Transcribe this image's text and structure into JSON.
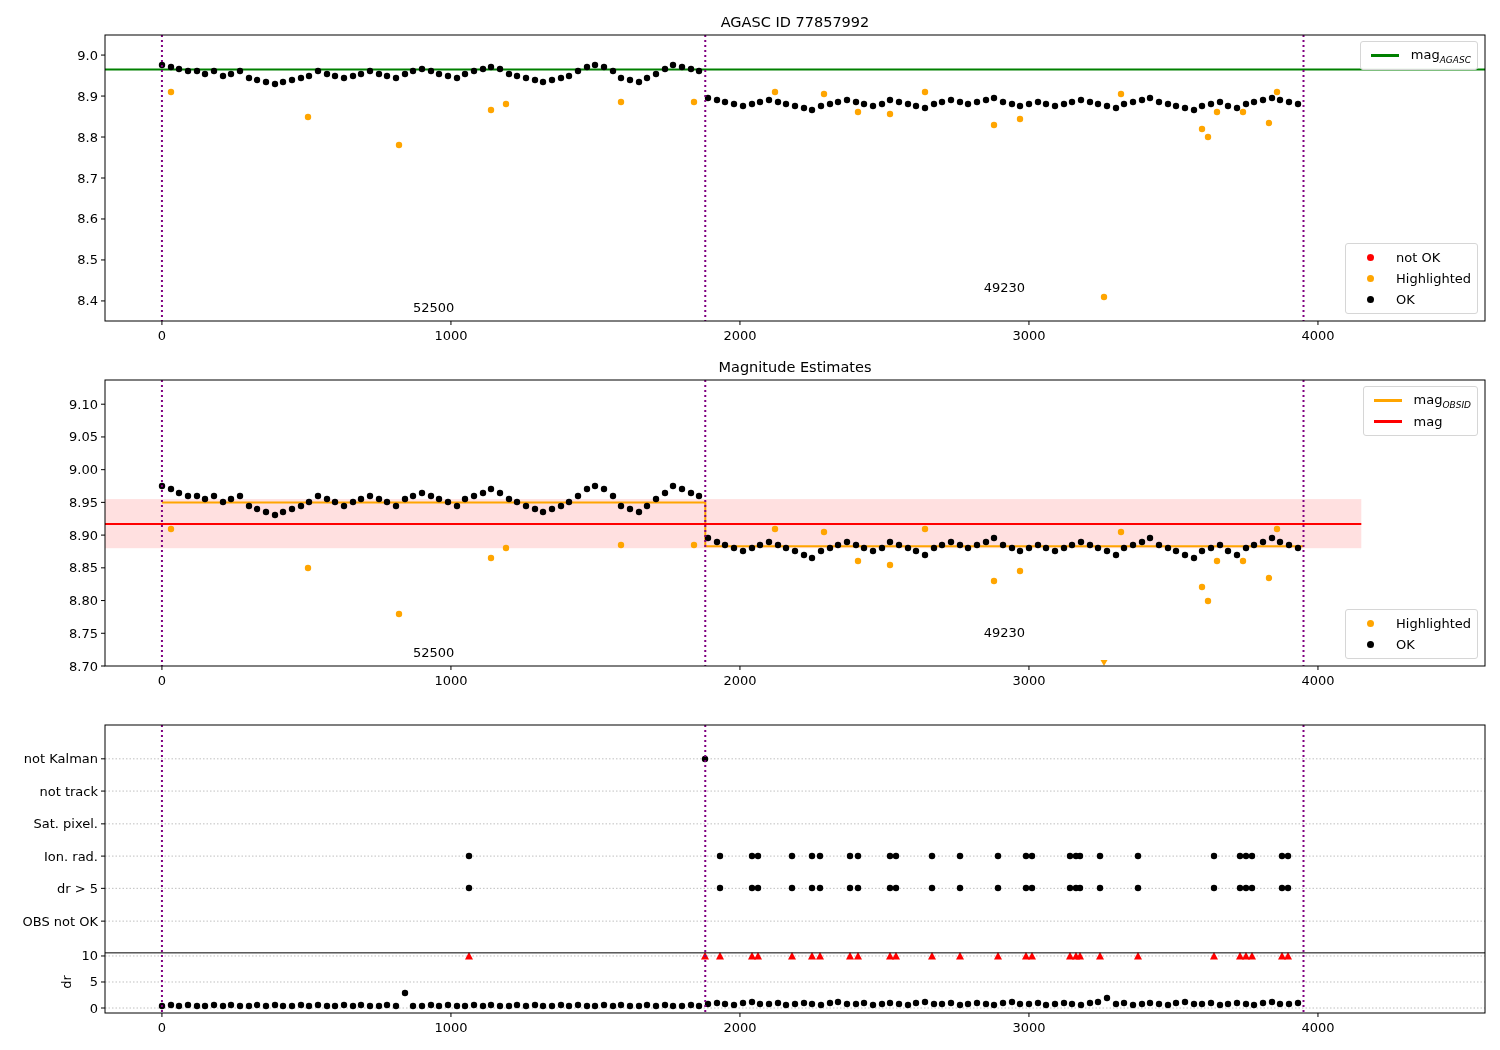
{
  "figure": {
    "panels": [
      {
        "chart_data": {
          "type": "scatter",
          "title": "AGASC ID 77857992",
          "xlim": [
            -197,
            4578
          ],
          "ylim": [
            8.351,
            9.049
          ],
          "xticks": [
            0,
            1000,
            2000,
            3000,
            4000
          ],
          "yticks": [
            {
              "value": 8.4,
              "label": "8.4"
            },
            {
              "value": 8.5,
              "label": "8.5"
            },
            {
              "value": 8.6,
              "label": "8.6"
            },
            {
              "value": 8.7,
              "label": "8.7"
            },
            {
              "value": 8.8,
              "label": "8.8"
            },
            {
              "value": 8.9,
              "label": "8.9"
            },
            {
              "value": 9.0,
              "label": "9.0"
            }
          ],
          "series": [
            {
              "name": "mag$_{AGASC}$",
              "type": "line",
              "color": "#008000",
              "x": [
                -197,
                4578
              ],
              "values": [
                8.965,
                8.965
              ]
            },
            {
              "name": "not OK",
              "type": "scatter",
              "color": "#ff0000"
            },
            {
              "name": "Highlighted",
              "type": "scatter",
              "color": "#ffa500",
              "x": [
                30,
                505,
                820,
                1140,
                1190,
                1590,
                1840,
                2120,
                2290,
                2410,
                2520,
                2640,
                2880,
                2970,
                3260,
                3320,
                3600,
                3620,
                3650,
                3740,
                3830,
                3860
              ],
              "values": [
                8.91,
                8.85,
                8.78,
                8.865,
                8.88,
                8.885,
                8.885,
                8.91,
                8.905,
                8.86,
                8.855,
                8.91,
                8.83,
                8.845,
                8.41,
                8.905,
                8.82,
                8.8,
                8.86,
                8.86,
                8.835,
                8.91
              ]
            },
            {
              "name": "OK",
              "type": "scatter",
              "color": "#000000",
              "x": [
                0,
                30,
                60,
                90,
                120,
                150,
                180,
                210,
                240,
                270,
                300,
                330,
                360,
                390,
                420,
                450,
                480,
                510,
                540,
                570,
                600,
                630,
                660,
                690,
                720,
                750,
                780,
                810,
                840,
                870,
                900,
                930,
                960,
                990,
                1020,
                1050,
                1080,
                1110,
                1140,
                1170,
                1200,
                1230,
                1260,
                1290,
                1320,
                1350,
                1380,
                1410,
                1440,
                1470,
                1500,
                1530,
                1560,
                1590,
                1620,
                1650,
                1680,
                1710,
                1740,
                1770,
                1800,
                1830,
                1860,
                1890,
                1920,
                1950,
                1980,
                2010,
                2040,
                2070,
                2100,
                2130,
                2160,
                2190,
                2220,
                2250,
                2280,
                2310,
                2340,
                2370,
                2400,
                2430,
                2460,
                2490,
                2520,
                2550,
                2580,
                2610,
                2640,
                2670,
                2700,
                2730,
                2760,
                2790,
                2820,
                2850,
                2880,
                2910,
                2940,
                2970,
                3000,
                3030,
                3060,
                3090,
                3120,
                3150,
                3180,
                3210,
                3240,
                3270,
                3300,
                3330,
                3360,
                3390,
                3420,
                3450,
                3480,
                3510,
                3540,
                3570,
                3600,
                3630,
                3660,
                3690,
                3720,
                3750,
                3780,
                3810,
                3840,
                3870,
                3900,
                3930
              ],
              "values": [
                8.975,
                8.97,
                8.965,
                8.96,
                8.96,
                8.955,
                8.96,
                8.95,
                8.955,
                8.96,
                8.945,
                8.94,
                8.935,
                8.93,
                8.935,
                8.94,
                8.945,
                8.95,
                8.96,
                8.955,
                8.95,
                8.945,
                8.95,
                8.955,
                8.96,
                8.955,
                8.95,
                8.945,
                8.955,
                8.96,
                8.965,
                8.96,
                8.955,
                8.95,
                8.945,
                8.955,
                8.96,
                8.965,
                8.97,
                8.965,
                8.955,
                8.95,
                8.945,
                8.94,
                8.935,
                8.94,
                8.945,
                8.95,
                8.96,
                8.97,
                8.975,
                8.97,
                8.96,
                8.945,
                8.94,
                8.935,
                8.945,
                8.955,
                8.965,
                8.975,
                8.97,
                8.965,
                8.96,
                8.895,
                8.89,
                8.885,
                8.88,
                8.875,
                8.88,
                8.885,
                8.89,
                8.885,
                8.88,
                8.875,
                8.87,
                8.865,
                8.875,
                8.88,
                8.885,
                8.89,
                8.885,
                8.88,
                8.875,
                8.88,
                8.89,
                8.885,
                8.88,
                8.875,
                8.87,
                8.88,
                8.885,
                8.89,
                8.885,
                8.88,
                8.885,
                8.89,
                8.895,
                8.885,
                8.88,
                8.875,
                8.88,
                8.885,
                8.88,
                8.875,
                8.88,
                8.885,
                8.89,
                8.885,
                8.88,
                8.875,
                8.87,
                8.88,
                8.885,
                8.89,
                8.895,
                8.885,
                8.88,
                8.875,
                8.87,
                8.865,
                8.875,
                8.88,
                8.885,
                8.875,
                8.87,
                8.88,
                8.885,
                8.89,
                8.895,
                8.89,
                8.885,
                8.88
              ]
            }
          ],
          "ref_lines": [
            {
              "axis": "x",
              "value": 0
            },
            {
              "axis": "x",
              "value": 1880
            },
            {
              "axis": "x",
              "value": 3950
            }
          ],
          "annotations": [
            "52500",
            "49230"
          ]
        }
      },
      {
        "chart_data": {
          "type": "scatter",
          "title": "Magnitude Estimates",
          "xlim": [
            -197,
            4578
          ],
          "ylim": [
            8.7,
            9.137
          ],
          "xticks": [
            0,
            1000,
            2000,
            3000,
            4000
          ],
          "yticks": [
            {
              "value": 8.7,
              "label": "8.70"
            },
            {
              "value": 8.75,
              "label": "8.75"
            },
            {
              "value": 8.8,
              "label": "8.80"
            },
            {
              "value": 8.85,
              "label": "8.85"
            },
            {
              "value": 8.9,
              "label": "8.90"
            },
            {
              "value": 8.95,
              "label": "8.95"
            },
            {
              "value": 9.0,
              "label": "9.00"
            },
            {
              "value": 9.05,
              "label": "9.05"
            },
            {
              "value": 9.1,
              "label": "9.10"
            }
          ],
          "bands": [
            {
              "axis": "y",
              "from": 8.88,
              "to": 8.955,
              "color": "#ffe0e0"
            }
          ],
          "series": [
            {
              "name": "mag$_{OBSID}$",
              "type": "line",
              "color": "#ffa500",
              "x": [
                0,
                1880,
                1880,
                3950
              ],
              "values": [
                8.95,
                8.95,
                8.883,
                8.883
              ]
            },
            {
              "name": "mag",
              "type": "line",
              "color": "#ff0000",
              "x": [
                -197,
                4150
              ],
              "values": [
                8.917,
                8.917
              ]
            },
            {
              "name": "Highlighted",
              "type": "scatter",
              "color": "#ffa500",
              "x": [
                30,
                505,
                820,
                1140,
                1190,
                1590,
                1840,
                2120,
                2290,
                2410,
                2520,
                2640,
                2880,
                2970,
                3260,
                3320,
                3600,
                3620,
                3650,
                3740,
                3830,
                3860
              ],
              "values": [
                8.91,
                8.85,
                8.78,
                8.865,
                8.88,
                8.885,
                8.885,
                8.91,
                8.905,
                8.86,
                8.855,
                8.91,
                8.83,
                8.845,
                8.705,
                8.905,
                8.82,
                8.8,
                8.86,
                8.86,
                8.835,
                8.91
              ]
            },
            {
              "name": "OK",
              "type": "scatter",
              "color": "#000000",
              "x": [
                0,
                30,
                60,
                90,
                120,
                150,
                180,
                210,
                240,
                270,
                300,
                330,
                360,
                390,
                420,
                450,
                480,
                510,
                540,
                570,
                600,
                630,
                660,
                690,
                720,
                750,
                780,
                810,
                840,
                870,
                900,
                930,
                960,
                990,
                1020,
                1050,
                1080,
                1110,
                1140,
                1170,
                1200,
                1230,
                1260,
                1290,
                1320,
                1350,
                1380,
                1410,
                1440,
                1470,
                1500,
                1530,
                1560,
                1590,
                1620,
                1650,
                1680,
                1710,
                1740,
                1770,
                1800,
                1830,
                1860,
                1890,
                1920,
                1950,
                1980,
                2010,
                2040,
                2070,
                2100,
                2130,
                2160,
                2190,
                2220,
                2250,
                2280,
                2310,
                2340,
                2370,
                2400,
                2430,
                2460,
                2490,
                2520,
                2550,
                2580,
                2610,
                2640,
                2670,
                2700,
                2730,
                2760,
                2790,
                2820,
                2850,
                2880,
                2910,
                2940,
                2970,
                3000,
                3030,
                3060,
                3090,
                3120,
                3150,
                3180,
                3210,
                3240,
                3270,
                3300,
                3330,
                3360,
                3390,
                3420,
                3450,
                3480,
                3510,
                3540,
                3570,
                3600,
                3630,
                3660,
                3690,
                3720,
                3750,
                3780,
                3810,
                3840,
                3870,
                3900,
                3930
              ],
              "values": [
                8.975,
                8.97,
                8.965,
                8.96,
                8.96,
                8.955,
                8.96,
                8.95,
                8.955,
                8.96,
                8.945,
                8.94,
                8.935,
                8.93,
                8.935,
                8.94,
                8.945,
                8.95,
                8.96,
                8.955,
                8.95,
                8.945,
                8.95,
                8.955,
                8.96,
                8.955,
                8.95,
                8.945,
                8.955,
                8.96,
                8.965,
                8.96,
                8.955,
                8.95,
                8.945,
                8.955,
                8.96,
                8.965,
                8.97,
                8.965,
                8.955,
                8.95,
                8.945,
                8.94,
                8.935,
                8.94,
                8.945,
                8.95,
                8.96,
                8.97,
                8.975,
                8.97,
                8.96,
                8.945,
                8.94,
                8.935,
                8.945,
                8.955,
                8.965,
                8.975,
                8.97,
                8.965,
                8.96,
                8.895,
                8.89,
                8.885,
                8.88,
                8.875,
                8.88,
                8.885,
                8.89,
                8.885,
                8.88,
                8.875,
                8.87,
                8.865,
                8.875,
                8.88,
                8.885,
                8.89,
                8.885,
                8.88,
                8.875,
                8.88,
                8.89,
                8.885,
                8.88,
                8.875,
                8.87,
                8.88,
                8.885,
                8.89,
                8.885,
                8.88,
                8.885,
                8.89,
                8.895,
                8.885,
                8.88,
                8.875,
                8.88,
                8.885,
                8.88,
                8.875,
                8.88,
                8.885,
                8.89,
                8.885,
                8.88,
                8.875,
                8.87,
                8.88,
                8.885,
                8.89,
                8.895,
                8.885,
                8.88,
                8.875,
                8.87,
                8.865,
                8.875,
                8.88,
                8.885,
                8.875,
                8.87,
                8.88,
                8.885,
                8.89,
                8.895,
                8.89,
                8.885,
                8.88
              ]
            }
          ],
          "ref_lines": [
            {
              "axis": "x",
              "value": 0
            },
            {
              "axis": "x",
              "value": 1880
            },
            {
              "axis": "x",
              "value": 3950
            }
          ],
          "annotations": [
            "52500",
            "49230"
          ]
        }
      },
      {
        "chart_data": {
          "type": "scatter",
          "ylabel": "dr",
          "xlim": [
            -197,
            4578
          ],
          "ylim": [
            -0.96,
            54.4
          ],
          "xticks": [
            0,
            1000,
            2000,
            3000,
            4000
          ],
          "grid": true,
          "yticks": [
            0,
            5,
            10,
            {
              "value": 16.7,
              "label": "OBS not OK"
            },
            {
              "value": 23.0,
              "label": "dr > 5"
            },
            {
              "value": 29.2,
              "label": "Ion. rad."
            },
            {
              "value": 35.4,
              "label": "Sat. pixel."
            },
            {
              "value": 41.7,
              "label": "not track"
            },
            {
              "value": 47.9,
              "label": "not Kalman"
            }
          ],
          "series": [
            {
              "type": "scatter",
              "color": "#000000",
              "x": [
                1880,
                1062,
                1931,
                2042,
                2062,
                2180,
                2249,
                2277,
                2381,
                2408,
                2519,
                2540,
                2664,
                2761,
                2893,
                2990,
                3010,
                3142,
                3163,
                3176,
                3246,
                3377,
                3640,
                3730,
                3751,
                3772,
                3875,
                3896,
                1062,
                1931,
                2042,
                2062,
                2180,
                2249,
                2277,
                2381,
                2408,
                2519,
                2540,
                2664,
                2761,
                2893,
                2990,
                3010,
                3142,
                3163,
                3176,
                3246,
                3377,
                3640,
                3730,
                3751,
                3772,
                3875,
                3896
              ],
              "values": [
                47.9,
                29.2,
                29.2,
                29.2,
                29.2,
                29.2,
                29.2,
                29.2,
                29.2,
                29.2,
                29.2,
                29.2,
                29.2,
                29.2,
                29.2,
                29.2,
                29.2,
                29.2,
                29.2,
                29.2,
                29.2,
                29.2,
                29.2,
                29.2,
                29.2,
                29.2,
                29.2,
                29.2,
                23.0,
                23.0,
                23.0,
                23.0,
                23.0,
                23.0,
                23.0,
                23.0,
                23.0,
                23.0,
                23.0,
                23.0,
                23.0,
                23.0,
                23.0,
                23.0,
                23.0,
                23.0,
                23.0,
                23.0,
                23.0,
                23.0,
                23.0,
                23.0,
                23.0,
                23.0,
                23.0
              ]
            },
            {
              "type": "scatter",
              "color": "#000000",
              "x": [
                0,
                30,
                60,
                90,
                120,
                150,
                180,
                210,
                240,
                270,
                300,
                330,
                360,
                390,
                420,
                450,
                480,
                510,
                540,
                570,
                600,
                630,
                660,
                690,
                720,
                750,
                780,
                810,
                840,
                870,
                900,
                930,
                960,
                990,
                1020,
                1050,
                1080,
                1110,
                1140,
                1170,
                1200,
                1230,
                1260,
                1290,
                1320,
                1350,
                1380,
                1410,
                1440,
                1470,
                1500,
                1530,
                1560,
                1590,
                1620,
                1650,
                1680,
                1710,
                1740,
                1770,
                1800,
                1830,
                1860,
                1890,
                1920,
                1950,
                1980,
                2010,
                2040,
                2070,
                2100,
                2130,
                2160,
                2190,
                2220,
                2250,
                2280,
                2310,
                2340,
                2370,
                2400,
                2430,
                2460,
                2490,
                2520,
                2550,
                2580,
                2610,
                2640,
                2670,
                2700,
                2730,
                2760,
                2790,
                2820,
                2850,
                2880,
                2910,
                2940,
                2970,
                3000,
                3030,
                3060,
                3090,
                3120,
                3150,
                3180,
                3210,
                3240,
                3270,
                3300,
                3330,
                3360,
                3390,
                3420,
                3450,
                3480,
                3510,
                3540,
                3570,
                3600,
                3630,
                3660,
                3690,
                3720,
                3750,
                3780,
                3810,
                3840,
                3870,
                3900,
                3930
              ],
              "values": [
                0.3,
                0.5,
                0.4,
                0.6,
                0.3,
                0.4,
                0.5,
                0.3,
                0.6,
                0.4,
                0.3,
                0.5,
                0.4,
                0.6,
                0.3,
                0.4,
                0.5,
                0.3,
                0.6,
                0.4,
                0.3,
                0.5,
                0.4,
                0.6,
                0.3,
                0.4,
                0.5,
                0.3,
                2.8,
                0.4,
                0.3,
                0.5,
                0.4,
                0.6,
                0.3,
                0.4,
                0.5,
                0.3,
                0.6,
                0.4,
                0.3,
                0.5,
                0.4,
                0.6,
                0.3,
                0.4,
                0.5,
                0.3,
                0.6,
                0.4,
                0.3,
                0.5,
                0.4,
                0.6,
                0.3,
                0.4,
                0.5,
                0.3,
                0.6,
                0.4,
                0.3,
                0.5,
                0.4,
                0.7,
                1.0,
                0.8,
                0.6,
                0.9,
                1.1,
                0.7,
                0.8,
                1.0,
                0.6,
                0.7,
                1.0,
                0.8,
                0.6,
                0.9,
                1.1,
                0.7,
                0.8,
                1.0,
                0.6,
                0.7,
                1.0,
                0.8,
                0.6,
                0.9,
                1.1,
                0.7,
                0.8,
                1.0,
                0.6,
                0.7,
                1.0,
                0.8,
                0.6,
                0.9,
                1.1,
                0.7,
                0.8,
                1.0,
                0.6,
                0.7,
                1.0,
                0.8,
                0.6,
                0.9,
                1.1,
                2.0,
                0.8,
                1.0,
                0.6,
                0.7,
                1.0,
                0.8,
                0.6,
                0.9,
                1.1,
                0.7,
                0.8,
                1.0,
                0.6,
                0.7,
                1.0,
                0.8,
                0.6,
                0.9,
                1.1,
                0.7,
                0.8,
                1.0
              ]
            },
            {
              "type": "scatter",
              "color": "#ff0000",
              "x": [
                1062,
                1880,
                1931,
                2042,
                2062,
                2180,
                2249,
                2277,
                2381,
                2408,
                2519,
                2540,
                2664,
                2761,
                2893,
                2990,
                3010,
                3142,
                3163,
                3176,
                3246,
                3377,
                3640,
                3730,
                3751,
                3772,
                3875,
                3896
              ],
              "values": [
                10,
                10,
                10,
                10,
                10,
                10,
                10,
                10,
                10,
                10,
                10,
                10,
                10,
                10,
                10,
                10,
                10,
                10,
                10,
                10,
                10,
                10,
                10,
                10,
                10,
                10,
                10,
                10
              ]
            }
          ],
          "ref_lines": [
            {
              "axis": "x",
              "value": 0
            },
            {
              "axis": "x",
              "value": 1880
            },
            {
              "axis": "x",
              "value": 3950
            },
            {
              "axis": "y",
              "value": 10.6
            }
          ]
        }
      }
    ]
  }
}
